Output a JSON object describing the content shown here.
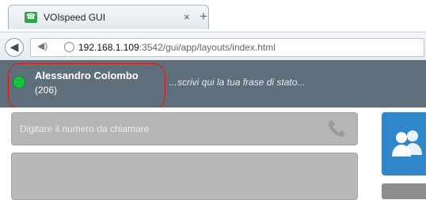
{
  "browser": {
    "tab_title": "VOIspeed GUI",
    "tab_close": "×",
    "new_tab": "+",
    "url_host": "192.168.1.109",
    "url_path": ":3542/gui/app/layouts/index.html"
  },
  "header": {
    "user_name": "Alessandro Colombo",
    "extension": "(206)",
    "status_placeholder": "...scrivi qui la tua frase di stato...",
    "presence_color": "#19c43a"
  },
  "main": {
    "dial_placeholder": "Digitare il numero da chiamare"
  },
  "icons": [
    "phone-icon",
    "back-arrow-icon",
    "speaker-icon",
    "globe-icon",
    "handset-icon",
    "contacts-icon"
  ]
}
